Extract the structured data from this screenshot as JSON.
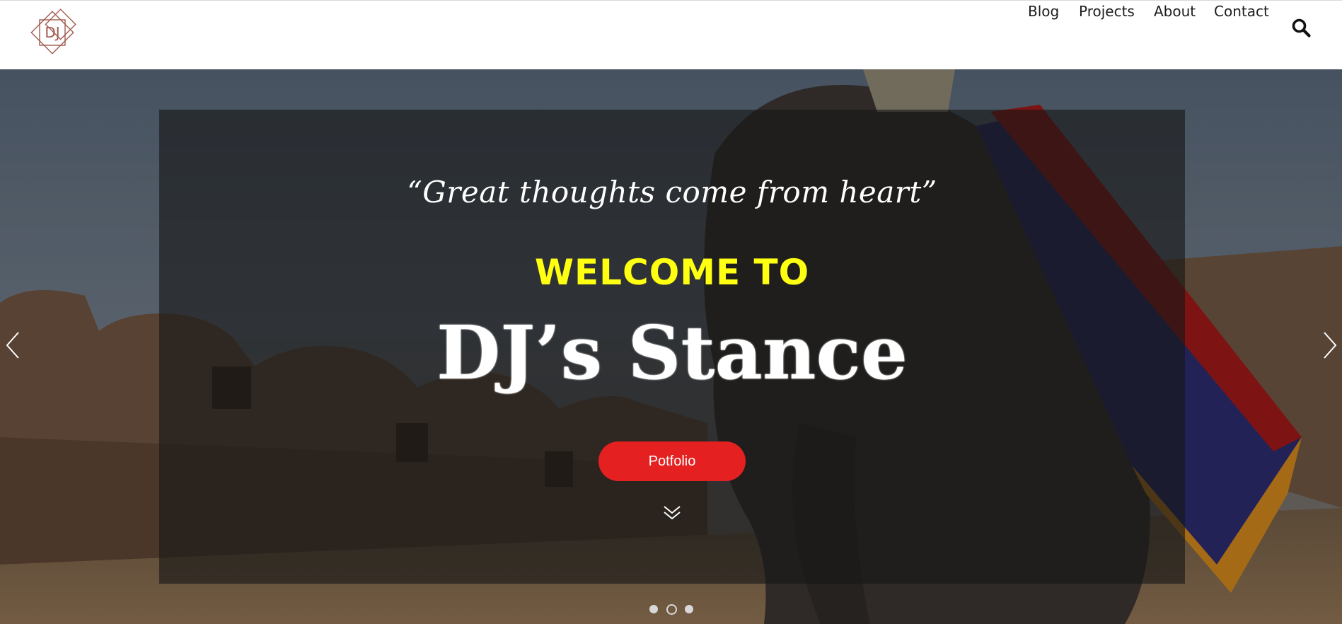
{
  "header": {
    "logo_text": "DJ",
    "nav": [
      {
        "label": "Blog"
      },
      {
        "label": "Projects"
      },
      {
        "label": "About"
      },
      {
        "label": "Contact"
      }
    ],
    "search_icon": "search-icon"
  },
  "hero": {
    "quote": "“Great thoughts come from heart”",
    "welcome": "WELCOME TO",
    "title": "DJ’s Stance",
    "cta_label": "Potfolio",
    "scroll_icon": "double-chevron-down-icon",
    "prev_icon": "chevron-left-icon",
    "next_icon": "chevron-right-icon",
    "slides_total": 3,
    "active_slide": 2
  },
  "colors": {
    "accent_red": "#e52020",
    "welcome_yellow": "#ffff11",
    "logo": "#a05a4e"
  }
}
